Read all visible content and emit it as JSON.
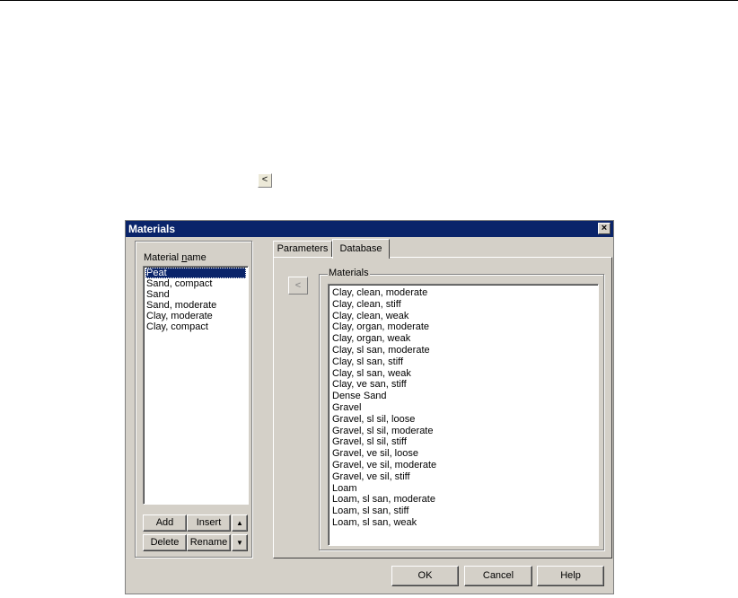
{
  "document": {
    "back_button_label": "<"
  },
  "dialog": {
    "title": "Materials",
    "close_label": "×",
    "material_name_label": "Material name",
    "material_names": [
      "Peat",
      "Sand, compact",
      "Sand",
      "Sand, moderate",
      "Clay, moderate",
      "Clay, compact"
    ],
    "selected_index": 0,
    "buttons": {
      "add": "Add",
      "insert": "Insert",
      "delete": "Delete",
      "rename": "Rename",
      "up": "▲",
      "down": "▼"
    },
    "tabs": [
      {
        "label": "Parameters",
        "active": false
      },
      {
        "label": "Database",
        "active": true
      }
    ],
    "database": {
      "copy_button_label": "<",
      "group_label": "Materials",
      "items": [
        "Clay, clean, moderate",
        "Clay, clean, stiff",
        "Clay, clean, weak",
        "Clay, organ, moderate",
        "Clay, organ, weak",
        "Clay, sl san, moderate",
        "Clay, sl san, stiff",
        "Clay, sl san, weak",
        "Clay, ve san, stiff",
        "Dense Sand",
        "Gravel",
        "Gravel, sl sil, loose",
        "Gravel, sl sil, moderate",
        "Gravel, sl sil, stiff",
        "Gravel, ve sil, loose",
        "Gravel, ve sil, moderate",
        "Gravel, ve sil, stiff",
        "Loam",
        "Loam, sl san, moderate",
        "Loam, sl san, stiff",
        "Loam, sl san, weak"
      ]
    },
    "footer": {
      "ok": "OK",
      "cancel": "Cancel",
      "help": "Help"
    }
  },
  "colors": {
    "titlebar": "#0a246a",
    "dialog_face": "#d4d0c8",
    "selection": "#0a246a"
  }
}
